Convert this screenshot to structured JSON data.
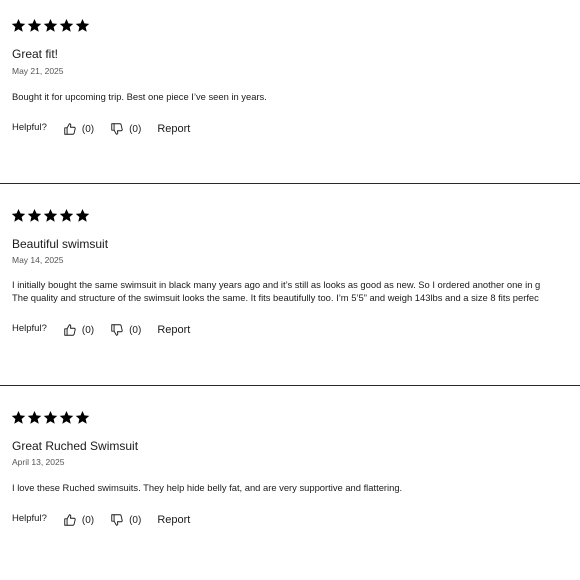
{
  "helpful_label": "Helpful?",
  "report_label": "Report",
  "reviews": [
    {
      "rating": 5,
      "title": "Great fit!",
      "date": "May 21, 2025",
      "body": [
        "Bought it for upcoming trip. Best one piece I’ve seen in years."
      ],
      "helpful_yes": "(0)",
      "helpful_no": "(0)"
    },
    {
      "rating": 5,
      "title": "Beautiful swimsuit",
      "date": "May 14, 2025",
      "body": [
        "I initially bought the same swimsuit in black many years ago and it’s still as looks as good as new. So I ordered another one in g",
        "The quality and structure of the swimsuit looks the same. It fits beautifully too. I’m 5’5” and weigh 143lbs and a size 8 fits perfec"
      ],
      "helpful_yes": "(0)",
      "helpful_no": "(0)"
    },
    {
      "rating": 5,
      "title": "Great Ruched Swimsuit",
      "date": "April 13, 2025",
      "body": [
        "I love these Ruched swimsuits. They help hide belly fat, and are very supportive and flattering."
      ],
      "helpful_yes": "(0)",
      "helpful_no": "(0)"
    }
  ],
  "colors": {
    "text": "#1a1a1a",
    "muted": "#555555",
    "star": "#000000",
    "divider": "#2a2a2a"
  },
  "icons": {
    "star": "star-icon",
    "thumbs_up": "thumbs-up-icon",
    "thumbs_down": "thumbs-down-icon"
  }
}
